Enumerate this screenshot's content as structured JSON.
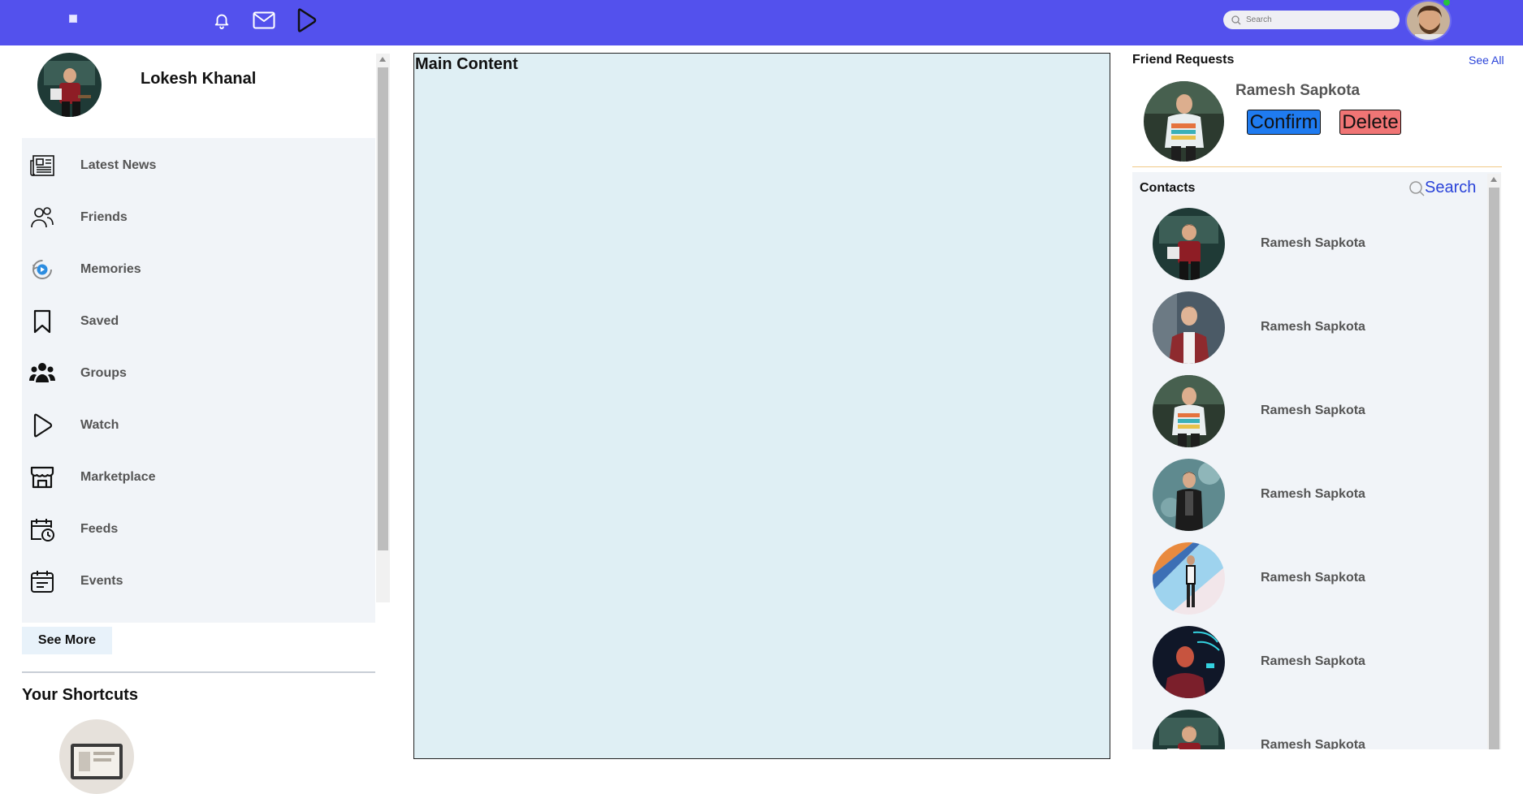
{
  "header": {
    "search_placeholder": "Search",
    "nav_icons": [
      "bell-icon",
      "mail-icon",
      "play-icon"
    ],
    "accent_color": "#5351ed",
    "online_status_color": "#26c43b"
  },
  "profile": {
    "name": "Lokesh Khanal"
  },
  "sidebar": {
    "items": [
      {
        "label": "Latest News",
        "icon": "newspaper-icon"
      },
      {
        "label": "Friends",
        "icon": "friends-icon"
      },
      {
        "label": "Memories",
        "icon": "memories-icon"
      },
      {
        "label": "Saved",
        "icon": "bookmark-icon"
      },
      {
        "label": "Groups",
        "icon": "groups-icon"
      },
      {
        "label": "Watch",
        "icon": "play-icon"
      },
      {
        "label": "Marketplace",
        "icon": "store-icon"
      },
      {
        "label": "Feeds",
        "icon": "calendar-clock-icon"
      },
      {
        "label": "Events",
        "icon": "calendar-icon"
      }
    ],
    "see_more_label": "See More",
    "shortcuts_title": "Your Shortcuts"
  },
  "main": {
    "title": "Main Content"
  },
  "friend_requests": {
    "title": "Friend Requests",
    "see_all_label": "See All",
    "request": {
      "name": "Ramesh Sapkota",
      "confirm_label": "Confirm",
      "delete_label": "Delete"
    },
    "confirm_color": "#1f7bf0",
    "delete_color": "#f07575"
  },
  "contacts": {
    "title": "Contacts",
    "search_label": "Search",
    "items": [
      {
        "name": "Ramesh Sapkota"
      },
      {
        "name": "Ramesh Sapkota"
      },
      {
        "name": "Ramesh Sapkota"
      },
      {
        "name": "Ramesh Sapkota"
      },
      {
        "name": "Ramesh Sapkota"
      },
      {
        "name": "Ramesh Sapkota"
      },
      {
        "name": "Ramesh Sapkota"
      }
    ]
  }
}
